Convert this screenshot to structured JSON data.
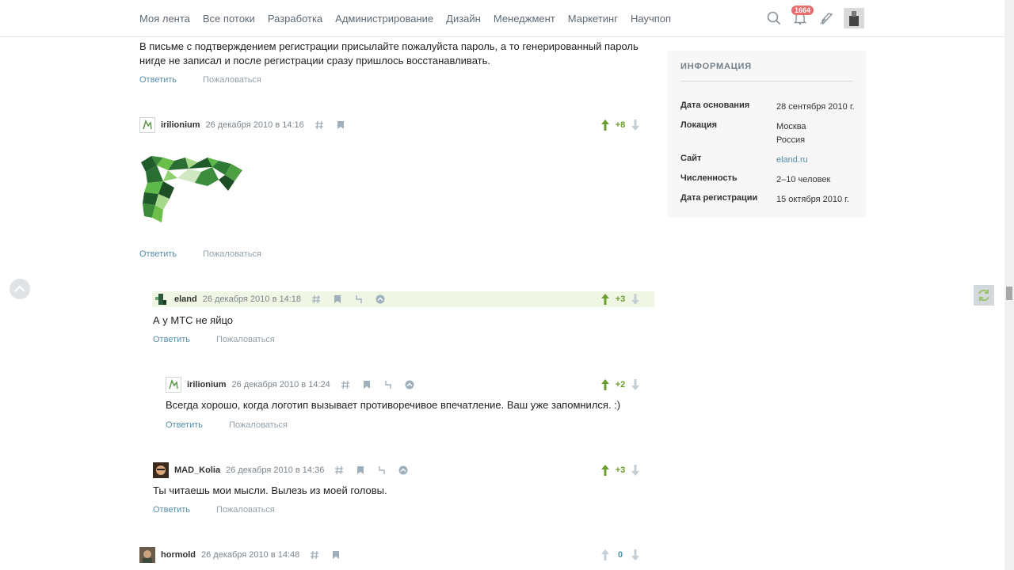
{
  "nav": {
    "items": [
      "Моя лента",
      "Все потоки",
      "Разработка",
      "Администрирование",
      "Дизайн",
      "Менеджмент",
      "Маркетинг",
      "Научпоп"
    ],
    "notifications_count": "1664",
    "icons": [
      "search-icon",
      "bell-icon",
      "quill-icon",
      "user-avatar"
    ]
  },
  "top_comment": {
    "text": "В письме с подтверждением регистрации присылайте пожалуйста пароль, а то генерированный пароль нигде не записал и после регистрации сразу пришлось восстанавливать.",
    "reply": "Ответить",
    "report": "Пожаловаться"
  },
  "comments": [
    {
      "nick": "irilionium",
      "date": "26 декабря 2010 в 14:16",
      "score": "+8",
      "text": "",
      "reply": "Ответить",
      "report": "Пожаловаться"
    },
    {
      "nick": "eland",
      "date": "26 декабря 2010 в 14:18",
      "score": "+3",
      "text": "А у МТС не яйцо",
      "reply": "Ответить",
      "report": "Пожаловаться"
    },
    {
      "nick": "irilionium",
      "date": "26 декабря 2010 в 14:24",
      "score": "+2",
      "text": "Всегда хорошо, когда логотип вызывает противоречивое впечатление. Ваш уже запомнился. :)",
      "reply": "Ответить",
      "report": "Пожаловаться"
    },
    {
      "nick": "MAD_Kolia",
      "date": "26 декабря 2010 в 14:36",
      "score": "+3",
      "text": "Ты читаешь мои мысли. Вылезь из моей головы.",
      "reply": "Ответить",
      "report": "Пожаловаться"
    },
    {
      "nick": "hormold",
      "date": "26 декабря 2010 в 14:48",
      "score": "0"
    }
  ],
  "info": {
    "title": "ИНФОРМАЦИЯ",
    "rows": [
      {
        "key": "Дата основания",
        "value": "28 сентября 2010 г."
      },
      {
        "key": "Локация",
        "value": "Москва",
        "value2": "Россия"
      },
      {
        "key": "Сайт",
        "value": "eland.ru"
      },
      {
        "key": "Численность",
        "value": "2–10 человек"
      },
      {
        "key": "Дата регистрации",
        "value": "15 октября 2010 г."
      }
    ]
  },
  "colors": {
    "accent": "#548eaa",
    "positive": "#6c9d2f",
    "highlight": "#f0f6e4",
    "badge": "#e86e6e"
  }
}
